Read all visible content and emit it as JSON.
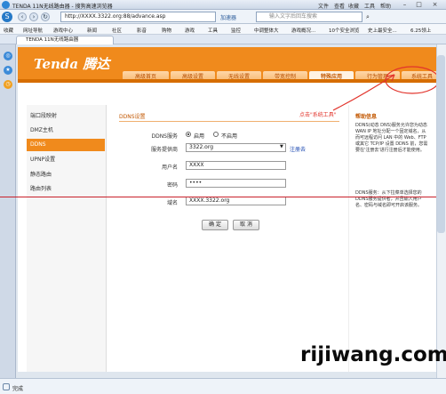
{
  "window": {
    "title": "TENDA 11N无线路由器 - 搜狗高速浏览器",
    "menu": [
      "文件",
      "查看",
      "收藏",
      "工具",
      "帮助"
    ]
  },
  "address": {
    "url": "http://XXXX.3322.org:88/advance.asp",
    "mode": "加速器",
    "search_placeholder": "输入文字后回车搜索"
  },
  "favorites": [
    "收藏",
    "网址导航",
    "游戏中心",
    "新闻",
    "社区",
    "影音",
    "购物",
    "游戏",
    "工具",
    "监控",
    "中调整体大",
    "游戏概况...",
    "10个安全浏览",
    "史上最安全...",
    "6.25领上"
  ],
  "tab": {
    "label": "TENDA 11N无线路由器"
  },
  "router": {
    "logo": "Tenda 腾达",
    "menu": [
      "高级首页",
      "高级设置",
      "无线设置",
      "带宽控制",
      "特殊应用",
      "行为管理",
      "系统工具"
    ],
    "active_menu": "特殊应用",
    "leftnav": [
      "端口段映射",
      "DMZ主机",
      "DDNS",
      "UPNP设置",
      "静态路由",
      "路由列表"
    ],
    "active_nav": "DDNS"
  },
  "form": {
    "section_title": "DDNS设置",
    "ddns_label": "DDNS服务",
    "enable_label": "启用",
    "disable_label": "不启用",
    "provider_label": "服务提供商",
    "provider_value": "3322.org",
    "register_link": "注册去",
    "user_label": "用户名",
    "user_value": "XXXX",
    "password_label": "密码",
    "password_value": "••••",
    "domain_label": "域名",
    "domain_value": "XXXX.3322.org",
    "ok_button": "确 定",
    "cancel_button": "取 消"
  },
  "help": {
    "title": "帮助信息",
    "paragraph1": "DDNS(动态 DNS)服务允许您为动态 WAN IP 地址分配一个固定域名，从而可远程访问 LAN 中的 Web、FTP 或其它 TCP/IP 设置 DDNS 前，您需要在'注册去'进行注册后才能使用。",
    "paragraph2": "DDNS服务：从下拉菜单选择您的DDNS服务提供者，并且输入用户名、密码与域名即可开启该服务。"
  },
  "annotation": "点击\"系统工具\"",
  "status": "完成",
  "watermark": "rijiwang.com",
  "colors": {
    "brand_orange": "#f08a1c",
    "annotation_red": "#e2342c"
  }
}
